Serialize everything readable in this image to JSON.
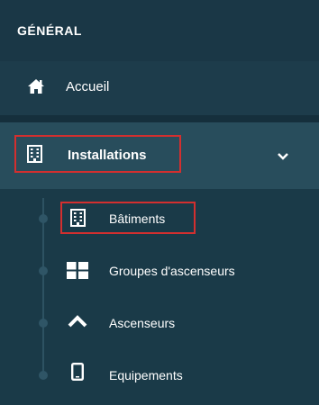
{
  "section": {
    "title": "GÉNÉRAL"
  },
  "menu": {
    "home": {
      "label": "Accueil",
      "icon": "home-icon"
    },
    "installations": {
      "label": "Installations",
      "icon": "building-icon",
      "expanded": true
    },
    "submenu": [
      {
        "label": "Bâtiments",
        "icon": "building-icon",
        "highlighted": true
      },
      {
        "label": "Groupes d'ascenseurs",
        "icon": "grid-icon"
      },
      {
        "label": "Ascenseurs",
        "icon": "chevron-up-icon"
      },
      {
        "label": "Equipements",
        "icon": "tablet-icon"
      }
    ]
  },
  "colors": {
    "background": "#1d3c4b",
    "accent": "#5ac8da",
    "highlight_border": "#d32f2f"
  }
}
